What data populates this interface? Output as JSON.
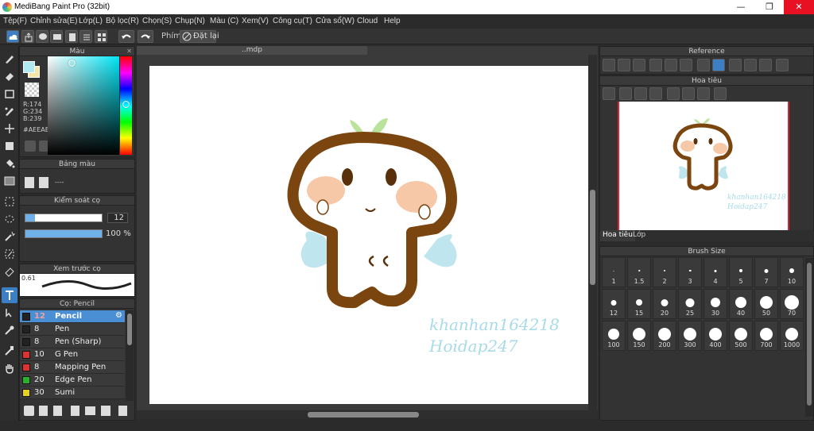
{
  "window": {
    "title": "MediBang Paint Pro (32bit)",
    "minimize": "—",
    "maximize": "❐",
    "close": "✕"
  },
  "menu": [
    "Tệp(F)",
    "Chỉnh sửa(E)",
    "Lớp(L)",
    "Bộ lọc(R)",
    "Chọn(S)",
    "Chụp(N)",
    "Màu (C)",
    "Xem(V)",
    "Công cụ(T)",
    "Cửa sổ(W)",
    "Cloud",
    "Help"
  ],
  "toolbar": {
    "shortcut_label": "Phím",
    "reset_label": "Đặt lại"
  },
  "color_panel": {
    "title": "Màu",
    "r": "R:174",
    "g": "G:234",
    "b": "B:239",
    "hex": "#AEEAEF",
    "current_color": "#aeeaef",
    "secondary_color": "#f5e6a8"
  },
  "palette_panel": {
    "title": "Bảng màu",
    "empty": "----"
  },
  "brush_control": {
    "title": "Kiểm soát cọ",
    "size_value": "12",
    "size_fraction": 0.12,
    "opacity_value": "100 %",
    "opacity_fraction": 1.0
  },
  "brush_preview": {
    "title": "Xem trước cọ",
    "value": "0.61"
  },
  "brush_panel": {
    "title": "Cọ: Pencil",
    "items": [
      {
        "size": "12",
        "name": "Pencil",
        "color": "#222222"
      },
      {
        "size": "8",
        "name": "Pen",
        "color": "#222222"
      },
      {
        "size": "8",
        "name": "Pen (Sharp)",
        "color": "#222222"
      },
      {
        "size": "10",
        "name": "G Pen",
        "color": "#e03030"
      },
      {
        "size": "8",
        "name": "Mapping Pen",
        "color": "#e03030"
      },
      {
        "size": "20",
        "name": "Edge Pen",
        "color": "#29b229"
      },
      {
        "size": "30",
        "name": "Sumi",
        "color": "#e8d020"
      }
    ]
  },
  "document": {
    "tab_title": "..mdp"
  },
  "watermark": {
    "line1": "khanhan164218",
    "line2": "Hoidap247"
  },
  "reference_panel": {
    "title": "Reference"
  },
  "navigator_panel": {
    "title": "Hoa tiêu",
    "watermark1": "khanhan164218",
    "watermark2": "Hoidap247"
  },
  "tabs": {
    "navigator": "Hoa tiêu",
    "layer": "Lớp"
  },
  "brush_size_panel": {
    "title": "Brush Size",
    "sizes": [
      "1",
      "1.5",
      "2",
      "3",
      "4",
      "5",
      "7",
      "10",
      "12",
      "15",
      "20",
      "25",
      "30",
      "40",
      "50",
      "70",
      "100",
      "150",
      "200",
      "300",
      "400",
      "500",
      "700",
      "1000"
    ]
  }
}
